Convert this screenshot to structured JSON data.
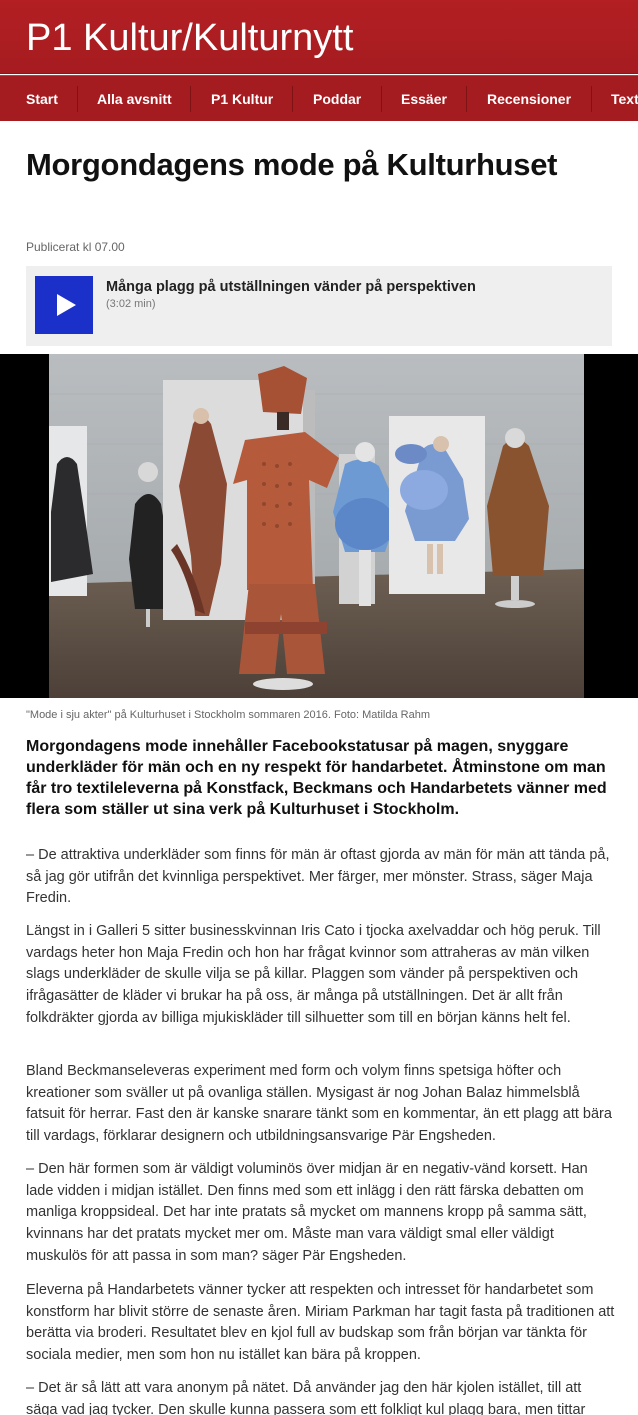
{
  "header": {
    "title": "P1 Kultur/Kulturnytt"
  },
  "nav": {
    "items": [
      "Start",
      "Alla avsnitt",
      "P1 Kultur",
      "Poddar",
      "Essäer",
      "Recensioner",
      "Text"
    ]
  },
  "article": {
    "headline": "Morgondagens mode på Kulturhuset",
    "published": "Publicerat kl 07.00",
    "audio": {
      "title": "Många plagg på utställningen vänder på perspektiven",
      "duration": "(3:02 min)"
    },
    "image_caption": "\"Mode i sju akter\" på Kulturhuset i Stockholm sommaren 2016. Foto: Matilda Rahm",
    "lead": "Morgondagens mode innehåller Facebookstatusar på magen, snyggare underkläder för män och en ny respekt för handarbetet. Åtminstone om man får tro textileleverna på Konstfack, Beckmans och Handarbetets vänner med flera som ställer ut sina verk på Kulturhuset i Stockholm.",
    "paragraphs": [
      "– De attraktiva underkläder som finns för män är oftast gjorda av män för män att tända på, så jag gör utifrån det kvinnliga perspektivet. Mer färger, mer mönster. Strass, säger Maja Fredin.",
      "Längst in i Galleri 5 sitter businesskvinnan Iris Cato i tjocka axelvaddar och hög peruk. Till vardags heter hon Maja Fredin och hon har frågat kvinnor som attraheras av män vilken slags underkläder de skulle vilja se på killar. Plaggen som vänder på perspektiven och ifrågasätter de kläder vi brukar ha på oss, är många på utställningen. Det är allt från folkdräkter gjorda av billiga mjukiskläder till silhuetter som till en början känns helt fel.",
      "Bland Beckmanseleveras experiment med form och volym finns spetsiga höfter och kreationer som sväller ut på ovanliga ställen. Mysigast är nog Johan Balaz himmelsblå fatsuit för herrar. Fast den är kanske snarare tänkt som en kommentar, än ett plagg att bära till vardags, förklarar designern och utbildningsansvarige Pär Engsheden.",
      "– Den här formen som är väldigt voluminös över midjan är en negativ-vänd korsett. Han lade vidden i midjan istället. Den finns med som ett inlägg i den rätt färska debatten om manliga kroppsideal. Det har inte pratats så mycket om mannens kropp på samma sätt, kvinnans har det pratats mycket mer om. Måste man vara väldigt smal eller väldigt muskulös för att passa in som man? säger Pär Engsheden.",
      "Eleverna på Handarbetets vänner tycker att respekten och intresset för handarbetet som konstform har blivit större de senaste åren. Miriam Parkman har tagit fasta på traditionen att berätta via broderi. Resultatet blev en kjol full av budskap som från början var tänkta för sociala medier, men som hon nu istället kan bära på kroppen.",
      "– Det är så lätt att vara anonym på nätet. Då använder jag den här kjolen istället, till att säga vad jag tycker. Den skulle kunna passera som ett folkligt kul plagg bara, men tittar"
    ]
  },
  "colors": {
    "brand_red": "#a51c20",
    "play_button": "#1b30c8",
    "player_bg": "#efefef"
  }
}
